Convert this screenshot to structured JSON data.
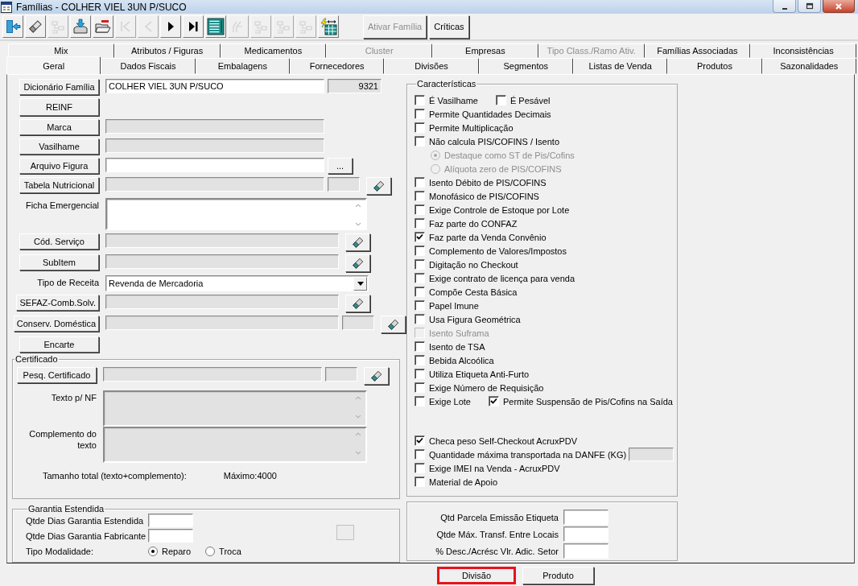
{
  "window": {
    "title": "Famílias - COLHER VIEL 3UN P/SUCO"
  },
  "toolbar": [
    {
      "kind": "exit",
      "disabled": false
    },
    {
      "kind": "eraser",
      "disabled": false
    },
    {
      "kind": "tree",
      "disabled": true
    },
    {
      "kind": "download",
      "disabled": false
    },
    {
      "kind": "folder",
      "disabled": false
    },
    {
      "kind": "first",
      "disabled": true
    },
    {
      "kind": "prev",
      "disabled": true
    },
    {
      "kind": "next",
      "disabled": false
    },
    {
      "kind": "last",
      "disabled": false
    },
    {
      "kind": "grid",
      "disabled": false
    },
    {
      "kind": "fork",
      "disabled": true
    },
    {
      "kind": "tree",
      "disabled": true
    },
    {
      "kind": "tree",
      "disabled": true
    },
    {
      "kind": "tree",
      "disabled": true
    },
    {
      "kind": "flash_grid",
      "disabled": false
    }
  ],
  "toolbar_buttons": [
    {
      "label": "Ativar Família",
      "disabled": true
    },
    {
      "label": "Críticas",
      "disabled": false
    }
  ],
  "tabs_back": [
    {
      "label": "Mix",
      "selected": false,
      "disabled": false
    },
    {
      "label": "Atributos / Figuras",
      "selected": false,
      "disabled": false
    },
    {
      "label": "Medicamentos",
      "selected": false,
      "disabled": false
    },
    {
      "label": "Cluster",
      "selected": false,
      "disabled": true
    },
    {
      "label": "Empresas",
      "selected": false,
      "disabled": false
    },
    {
      "label": "Tipo Class./Ramo Ativ.",
      "selected": false,
      "disabled": true
    },
    {
      "label": "Famílias Associadas",
      "selected": false,
      "disabled": false
    },
    {
      "label": "Inconsistências",
      "selected": false,
      "disabled": false
    }
  ],
  "tabs_front": [
    {
      "label": "Geral",
      "selected": true,
      "disabled": false
    },
    {
      "label": "Dados Fiscais",
      "selected": false,
      "disabled": false
    },
    {
      "label": "Embalagens",
      "selected": false,
      "disabled": false
    },
    {
      "label": "Fornecedores",
      "selected": false,
      "disabled": false
    },
    {
      "label": "Divisões",
      "selected": false,
      "disabled": false
    },
    {
      "label": "Segmentos",
      "selected": false,
      "disabled": false
    },
    {
      "label": "Listas de Venda",
      "selected": false,
      "disabled": false
    },
    {
      "label": "Produtos",
      "selected": false,
      "disabled": false
    },
    {
      "label": "Sazonalidades",
      "selected": false,
      "disabled": false
    }
  ],
  "form": {
    "rows": [
      {
        "kind": "button",
        "label": "Dicionário Família",
        "fields": [
          {
            "kind": "input",
            "value": "COLHER VIEL 3UN P/SUCO",
            "disabled": false
          },
          {
            "kind": "code",
            "value": "9321",
            "disabled": true
          }
        ]
      },
      {
        "kind": "tall_button",
        "label": "REINF"
      },
      {
        "kind": "button",
        "label": "Marca",
        "fields": [
          {
            "kind": "input",
            "disabled": true
          }
        ]
      },
      {
        "kind": "button",
        "label": "Vasilhame",
        "fields": [
          {
            "kind": "input",
            "disabled": true
          }
        ]
      },
      {
        "kind": "button",
        "label": "Arquivo Figura",
        "fields": [
          {
            "kind": "input",
            "disabled": false
          },
          {
            "kind": "browse",
            "label": "..."
          }
        ]
      },
      {
        "kind": "button",
        "label": "Tabela Nutricional",
        "fields": [
          {
            "kind": "input",
            "disabled": true
          },
          {
            "kind": "small",
            "disabled": true
          },
          {
            "kind": "eraser"
          }
        ]
      },
      {
        "kind": "label",
        "label": "Ficha Emergencial",
        "fields": [
          {
            "kind": "textarea",
            "disabled": false
          }
        ]
      },
      {
        "kind": "button",
        "label": "Cód. Serviço",
        "fields": [
          {
            "kind": "input_long",
            "disabled": true
          },
          {
            "kind": "eraser"
          }
        ]
      },
      {
        "kind": "button",
        "label": "SubItem",
        "fields": [
          {
            "kind": "input_long",
            "disabled": true
          },
          {
            "kind": "eraser"
          }
        ]
      },
      {
        "kind": "label",
        "label": "Tipo de Receita",
        "fields": [
          {
            "kind": "select",
            "value": "Revenda de Mercadoria"
          }
        ]
      },
      {
        "kind": "button",
        "label": "SEFAZ-Comb.Solv.",
        "fields": [
          {
            "kind": "input_long",
            "disabled": true
          },
          {
            "kind": "eraser"
          }
        ]
      },
      {
        "kind": "button",
        "label": "Conserv. Doméstica",
        "fields": [
          {
            "kind": "input_long",
            "disabled": true
          },
          {
            "kind": "small",
            "disabled": true
          },
          {
            "kind": "eraser"
          }
        ]
      },
      {
        "kind": "button",
        "label": "Encarte"
      }
    ]
  },
  "certificate": {
    "title": "Certificado",
    "rows": [
      {
        "kind": "button",
        "label": "Pesq. Certificado",
        "fields": [
          {
            "kind": "input",
            "disabled": true
          },
          {
            "kind": "small",
            "disabled": true
          },
          {
            "kind": "eraser"
          }
        ]
      },
      {
        "kind": "label",
        "label": "Texto p/ NF",
        "fields": [
          {
            "kind": "textarea",
            "disabled": true
          }
        ]
      },
      {
        "kind": "label",
        "label": "Complemento do texto",
        "fields": [
          {
            "kind": "textarea",
            "disabled": true
          }
        ]
      }
    ],
    "total_label": "Tamanho total (texto+complemento):",
    "max_label": "Máximo:4000"
  },
  "warranty": {
    "title": "Garantia Estendida",
    "fields": [
      {
        "label": "Qtde Dias Garantia Estendida"
      },
      {
        "label": "Qtde Dias Garantia Fabricante"
      }
    ],
    "modality_label": "Tipo Modalidade:",
    "modalities": [
      {
        "label": "Reparo",
        "selected": true
      },
      {
        "label": "Troca",
        "selected": false
      }
    ]
  },
  "characteristics": {
    "title": "Características",
    "items": [
      {
        "kind": "pair",
        "items": [
          {
            "label": "É Vasilhame",
            "checked": false,
            "disabled": false
          },
          {
            "label": "É Pesável",
            "checked": false,
            "disabled": false
          }
        ]
      },
      {
        "kind": "check",
        "label": "Permite Quantidades Decimais",
        "checked": false,
        "disabled": false
      },
      {
        "kind": "check",
        "label": "Permite Multiplicação",
        "checked": false,
        "disabled": false
      },
      {
        "kind": "check",
        "label": "Não calcula PIS/COFINS / Isento",
        "checked": false,
        "disabled": false
      },
      {
        "kind": "radio",
        "label": "Destaque como ST de Pis/Cofins",
        "selected": true,
        "disabled": true
      },
      {
        "kind": "radio",
        "label": "Alíquota zero de PIS/COFINS",
        "selected": false,
        "disabled": true
      },
      {
        "kind": "check",
        "label": "Isento Débito de PIS/COFINS",
        "checked": false,
        "disabled": false
      },
      {
        "kind": "check",
        "label": "Monofásico de PIS/COFINS",
        "checked": false,
        "disabled": false
      },
      {
        "kind": "check",
        "label": "Exige Controle de Estoque por Lote",
        "checked": false,
        "disabled": false
      },
      {
        "kind": "check",
        "label": "Faz parte do CONFAZ",
        "checked": false,
        "disabled": false
      },
      {
        "kind": "check",
        "label": "Faz parte da Venda Convênio",
        "checked": true,
        "disabled": false
      },
      {
        "kind": "check",
        "label": "Complemento de Valores/Impostos",
        "checked": false,
        "disabled": false
      },
      {
        "kind": "check",
        "label": "Digitação no Checkout",
        "checked": false,
        "disabled": false
      },
      {
        "kind": "check",
        "label": "Exige contrato de licença para venda",
        "checked": false,
        "disabled": false
      },
      {
        "kind": "check",
        "label": "Compõe Cesta Básica",
        "checked": false,
        "disabled": false
      },
      {
        "kind": "check",
        "label": "Papel Imune",
        "checked": false,
        "disabled": false
      },
      {
        "kind": "check",
        "label": "Usa Figura Geométrica",
        "checked": false,
        "disabled": false
      },
      {
        "kind": "check",
        "label": "Isento Suframa",
        "checked": false,
        "disabled": true
      },
      {
        "kind": "check",
        "label": "Isento de TSA",
        "checked": false,
        "disabled": false
      },
      {
        "kind": "check",
        "label": "Bebida Alcoólica",
        "checked": false,
        "disabled": false
      },
      {
        "kind": "check",
        "label": "Utiliza Etiqueta Anti-Furto",
        "checked": false,
        "disabled": false
      },
      {
        "kind": "check",
        "label": "Exige Número de Requisição",
        "checked": false,
        "disabled": false
      },
      {
        "kind": "pair",
        "items": [
          {
            "label": "Exige Lote",
            "checked": false,
            "disabled": false
          },
          {
            "label": "Permite Suspensão de Pis/Cofins na Saída",
            "checked": true,
            "disabled": false
          }
        ]
      }
    ],
    "items_lower": [
      {
        "kind": "check",
        "label": "Checa peso Self-Checkout AcruxPDV",
        "checked": true,
        "disabled": false
      },
      {
        "kind": "check_field",
        "label": "Quantidade máxima transportada na DANFE (KG)",
        "checked": false,
        "disabled": false
      },
      {
        "kind": "check",
        "label": "Exige IMEI na Venda - AcruxPDV",
        "checked": false,
        "disabled": false
      },
      {
        "kind": "check",
        "label": "Material de Apoio",
        "checked": false,
        "disabled": false
      }
    ]
  },
  "extras": [
    {
      "label": "Qtd Parcela Emissão Etiqueta"
    },
    {
      "label": "Qtde Máx. Transf. Entre Locais"
    },
    {
      "label": "% Desc./Acrésc Vlr. Adic. Setor"
    }
  ],
  "footer_buttons": [
    {
      "label": "Divisão",
      "highlighted": true
    },
    {
      "label": "Produto",
      "highlighted": false
    }
  ]
}
